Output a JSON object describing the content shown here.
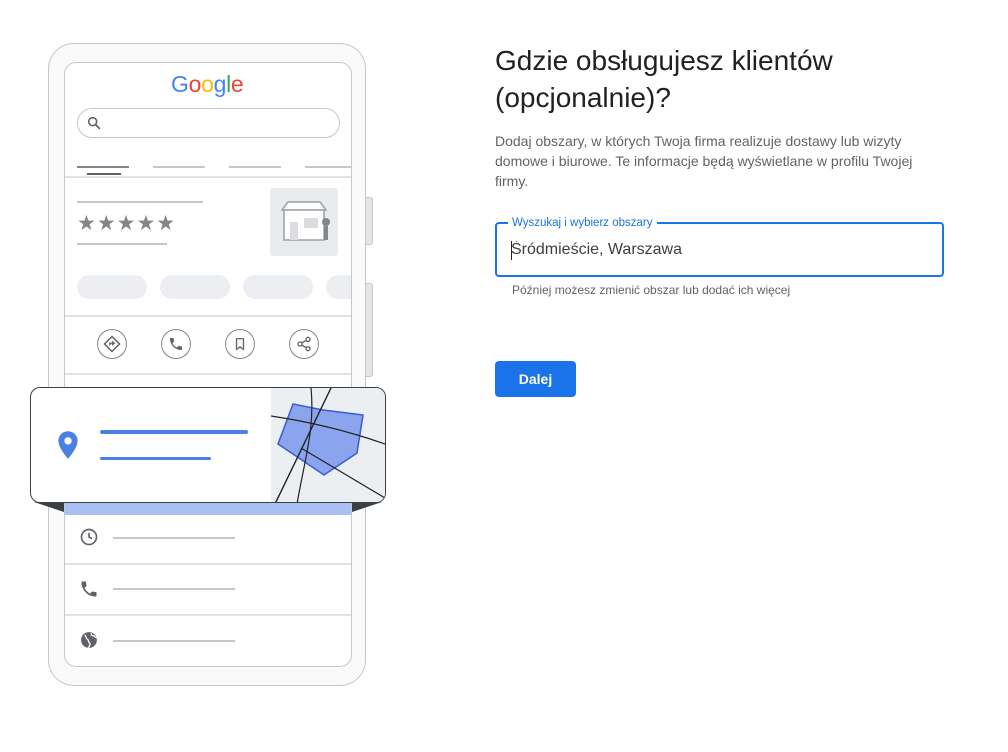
{
  "illustration": {
    "logo_letters": [
      {
        "ch": "G",
        "color": "#4285F4"
      },
      {
        "ch": "o",
        "color": "#EA4335"
      },
      {
        "ch": "o",
        "color": "#FBBC05"
      },
      {
        "ch": "g",
        "color": "#4285F4"
      },
      {
        "ch": "l",
        "color": "#34A853"
      },
      {
        "ch": "e",
        "color": "#EA4335"
      }
    ],
    "stars": "★★★★★",
    "icons": [
      "search-icon",
      "storefront-icon",
      "directions-icon",
      "phone-icon",
      "bookmark-icon",
      "share-icon",
      "location-pin-icon",
      "clock-icon",
      "phone-icon",
      "globe-icon"
    ],
    "accent_color": "#4a7fe5",
    "map_polygon_color": "#8ba4ee"
  },
  "main": {
    "title": "Gdzie obsługujesz klientów (opcjonalnie)?",
    "description": "Dodaj obszary, w których Twoja firma realizuje dostawy lub wizyty domowe i biurowe. Te informacje będą wyświetlane w profilu Twojej firmy.",
    "search": {
      "label": "Wyszukaj i wybierz obszary",
      "value": "Śródmieście, Warszawa",
      "helper": "Później możesz zmienić obszar lub dodać ich więcej"
    },
    "next_label": "Dalej",
    "primary_color": "#1a73e8"
  }
}
